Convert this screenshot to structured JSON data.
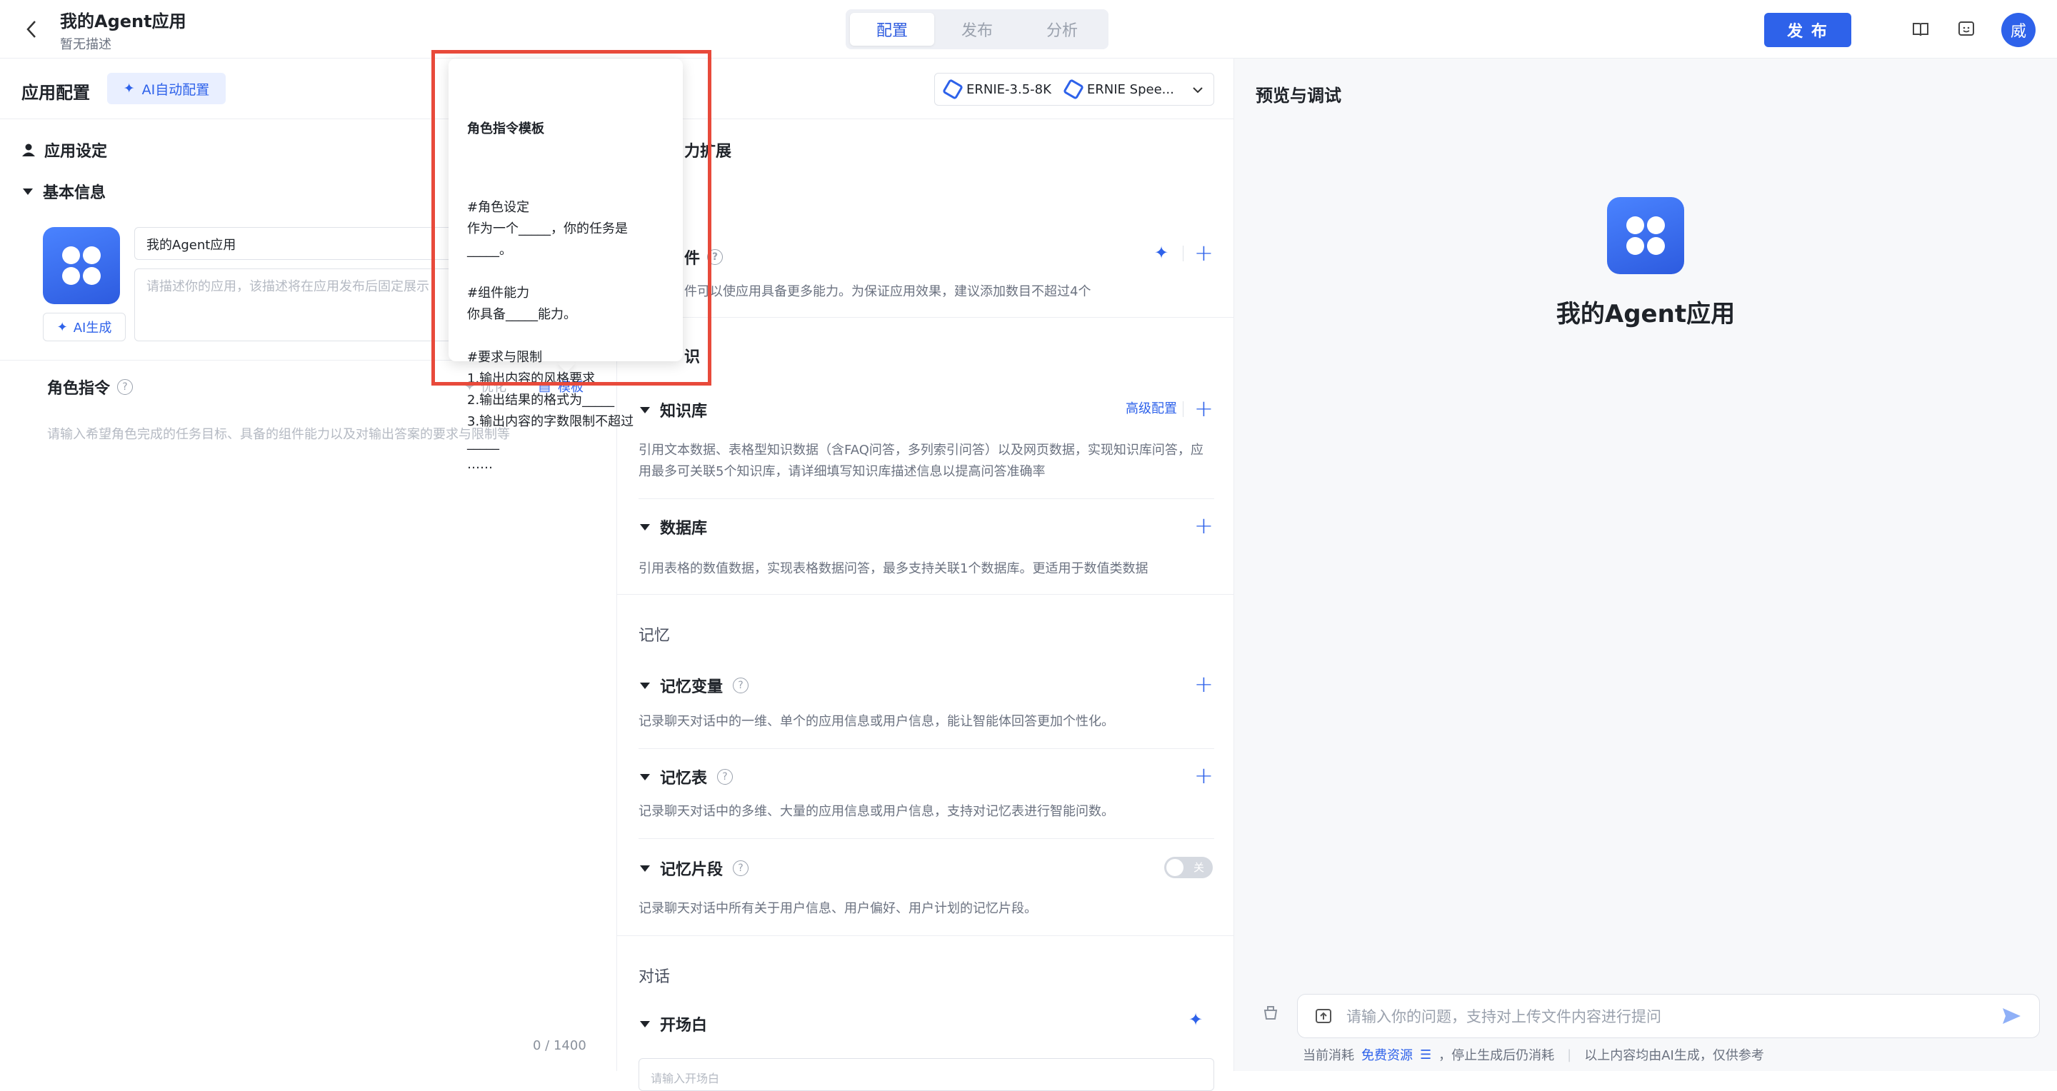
{
  "header": {
    "back_icon": "chevron-left-icon",
    "title": "我的Agent应用",
    "description": "暂无描述",
    "tabs": [
      "配置",
      "发布",
      "分析"
    ],
    "active_tab": "配置",
    "publish_label": "发 布",
    "avatar_text": "威",
    "accent_color": "#2e62ea"
  },
  "left": {
    "title": "应用配置",
    "ai_config_label": "AI自动配置",
    "settings_title": "应用设定",
    "basic_info_title": "基本信息",
    "name_value": "我的Agent应用",
    "description_placeholder": "请描述你的应用，该描述将在应用发布后固定展示",
    "ai_generate_label": "AI生成",
    "role_title": "角色指令",
    "optimize_label": "优化",
    "template_label": "模板",
    "role_placeholder": "请输入希望角色完成的任务目标、具备的组件能力以及对输出答案的要求与限制等",
    "counter": "0 / 1400"
  },
  "popup": {
    "title": "角色指令模板",
    "body": "#角色设定\n作为一个_____，你的任务是_____。\n\n#组件能力\n你具备_____能力。\n\n#要求与限制\n1.输出内容的风格要求_____\n2.输出结果的格式为_____\n3.输出内容的字数限制不超过_____\n……"
  },
  "middle": {
    "models": [
      "ERNIE-3.5-8K",
      "ERNIE Spee..."
    ],
    "ability_title_partial": "力扩展",
    "plugin_title_partial": "件",
    "plugin_desc": "件可以使应用具备更多能力。为保证应用效果，建议添加数目不超过4个",
    "knowledge_section_partial": "识",
    "kb_title": "知识库",
    "kb_advanced": "高级配置",
    "kb_desc": "引用文本数据、表格型知识数据（含FAQ问答，多列索引问答）以及网页数据，实现知识库问答，应用最多可关联5个知识库，请详细填写知识库描述信息以提高问答准确率",
    "db_title": "数据库",
    "db_desc": "引用表格的数值数据，实现表格数据问答，最多支持关联1个数据库。更适用于数值类数据",
    "memory_section": "记忆",
    "mem_var_title": "记忆变量",
    "mem_var_desc": "记录聊天对话中的一维、单个的应用信息或用户信息，能让智能体回答更加个性化。",
    "mem_table_title": "记忆表",
    "mem_table_desc": "记录聊天对话中的多维、大量的应用信息或用户信息，支持对记忆表进行智能问数。",
    "mem_snip_title": "记忆片段",
    "mem_snip_toggle": "关",
    "mem_snip_desc": "记录聊天对话中所有关于用户信息、用户偏好、用户计划的记忆片段。",
    "dialog_section": "对话",
    "opening_title": "开场白",
    "opening_placeholder": "请输入开场白"
  },
  "right": {
    "title": "预览与调试",
    "app_name": "我的Agent应用",
    "input_placeholder": "请输入你的问题，支持对上传文件内容进行提问",
    "footer_consumption": "当前消耗",
    "footer_free": "免费资源",
    "footer_stop": "，停止生成后仍消耗",
    "footer_ai": "以上内容均由AI生成，仅供参考"
  }
}
